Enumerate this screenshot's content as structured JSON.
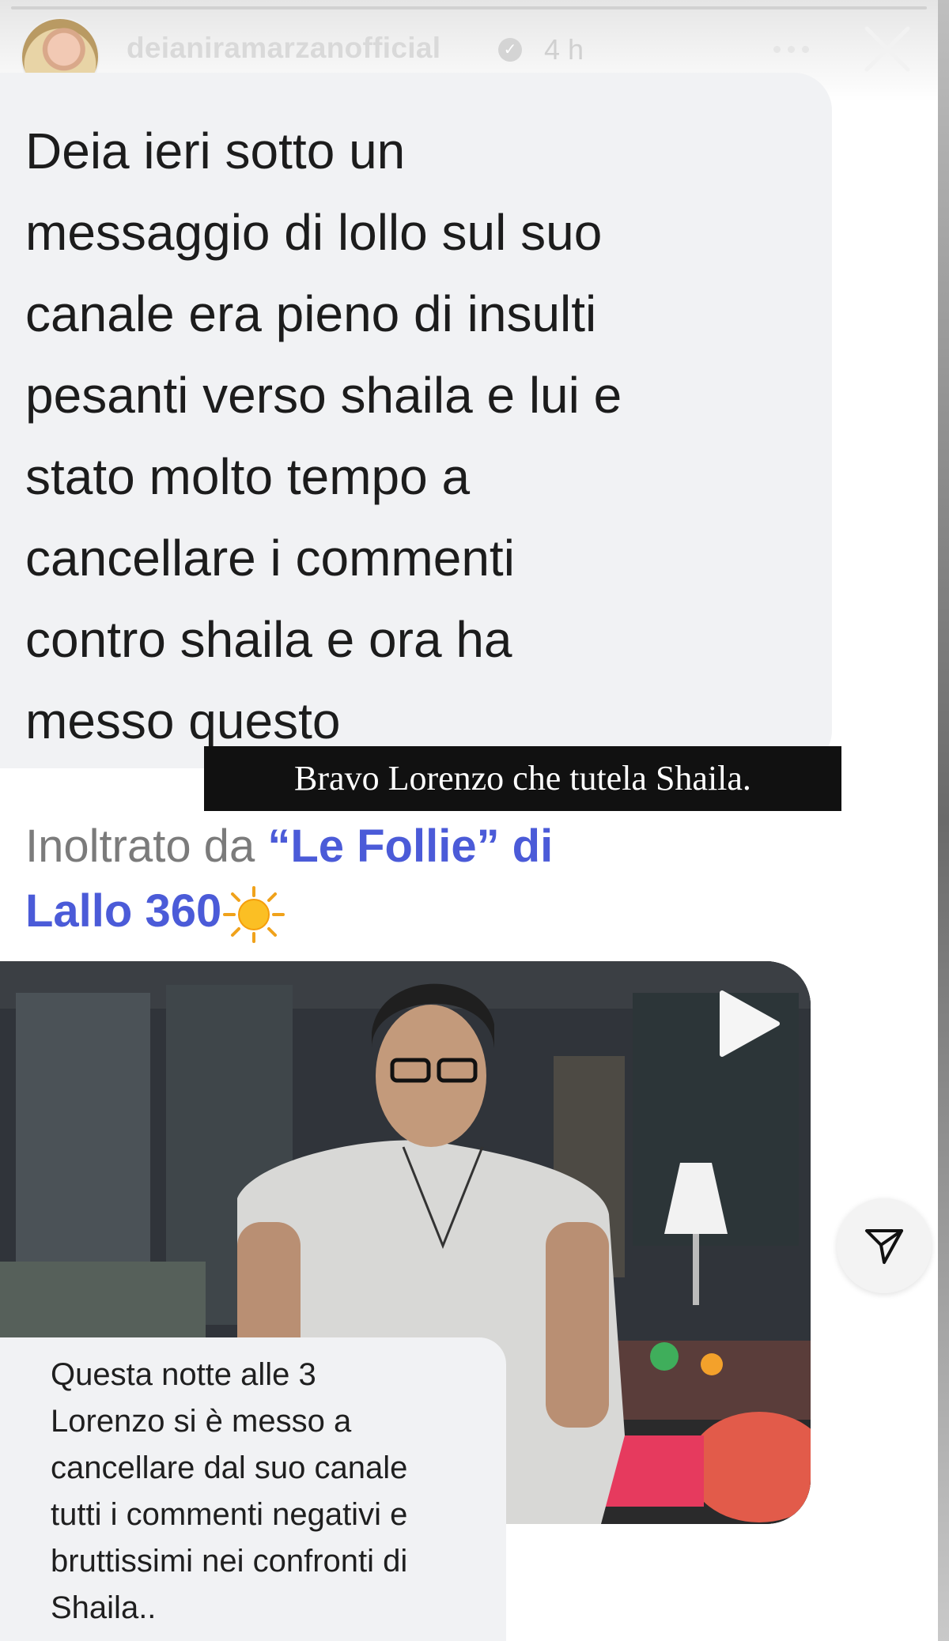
{
  "header": {
    "username": "deianiramarzanofficial",
    "time_ago": "4 h",
    "verified_icon": "verified-badge-icon",
    "more_icon": "more-dots-icon",
    "close_icon": "close-icon"
  },
  "story": {
    "main_message": "Deia ieri sotto un\nmessaggio di lollo sul suo\ncanale era pieno di insulti\npesanti verso shaila e lui e\nstato molto tempo a\ncancellare i commenti\ncontro shaila e ora ha\nmesso questo",
    "caption": "Bravo Lorenzo che tutela Shaila.",
    "forwarded_prefix": "Inoltrato da ",
    "forwarded_source": "“Le Follie” di\nLallo 360",
    "sun_icon": "sun-emoji-icon",
    "video": {
      "play_icon": "play-icon"
    },
    "secondary_message": "Questa notte alle 3\nLorenzo si è messo a\ncancellare dal suo canale\ntutti i commenti negativi e\nbruttissimi nei confronti di\nShaila.."
  },
  "actions": {
    "send_icon": "paper-plane-icon"
  },
  "colors": {
    "bubble_bg": "#f1f2f4",
    "link_blue": "#4b5bd8",
    "caption_bg": "#111111"
  }
}
